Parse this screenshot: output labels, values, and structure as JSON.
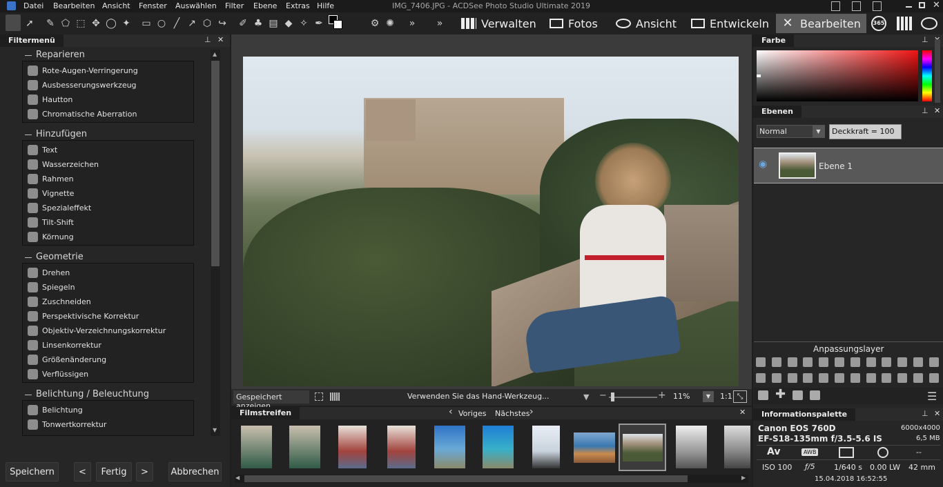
{
  "window": {
    "title": "IMG_7406.JPG - ACDSee Photo Studio Ultimate 2019"
  },
  "menu": [
    "Datei",
    "Bearbeiten",
    "Ansicht",
    "Fenster",
    "Auswählen",
    "Filter",
    "Ebene",
    "Extras",
    "Hilfe"
  ],
  "modes": [
    {
      "label": "Verwalten",
      "icon": "grid-icon"
    },
    {
      "label": "Fotos",
      "icon": "photos-icon"
    },
    {
      "label": "Ansicht",
      "icon": "eye-icon"
    },
    {
      "label": "Entwickeln",
      "icon": "develop-icon"
    },
    {
      "label": "Bearbeiten",
      "icon": "edit-icon",
      "active": true
    }
  ],
  "mode_extra": [
    "365"
  ],
  "filter_panel": {
    "title": "Filtermenü",
    "groups": [
      {
        "label": "Reparieren",
        "items": [
          "Rote-Augen-Verringerung",
          "Ausbesserungswerkzeug",
          "Hautton",
          "Chromatische Aberration"
        ]
      },
      {
        "label": "Hinzufügen",
        "items": [
          "Text",
          "Wasserzeichen",
          "Rahmen",
          "Vignette",
          "Spezialeffekt",
          "Tilt-Shift",
          "Körnung"
        ]
      },
      {
        "label": "Geometrie",
        "items": [
          "Drehen",
          "Spiegeln",
          "Zuschneiden",
          "Perspektivische Korrektur",
          "Objektiv-Verzeichnungskorrektur",
          "Linsenkorrektur",
          "Größenänderung",
          "Verflüssigen"
        ]
      },
      {
        "label": "Belichtung / Beleuchtung",
        "items": [
          "Belichtung",
          "Tonwertkorrektur"
        ]
      }
    ]
  },
  "bottom_buttons": {
    "save": "Speichern",
    "prev": "<",
    "done": "Fertig",
    "next": ">",
    "cancel": "Abbrechen"
  },
  "statusbar": {
    "show_saved": "Gespeichert anzeigen",
    "hint": "Verwenden Sie das Hand-Werkzeug...",
    "zoom": "11%",
    "ratio": "1:1"
  },
  "filmstrip": {
    "title": "Filmstreifen",
    "prev": "Voriges",
    "next": "Nächstes"
  },
  "color_panel": {
    "title": "Farbe"
  },
  "layers_panel": {
    "title": "Ebenen",
    "blend_mode": "Normal",
    "opacity": "Deckkraft = 100",
    "layer_name": "Ebene 1"
  },
  "adjust_panel": {
    "title": "Anpassungslayer"
  },
  "info_panel": {
    "title": "Informationspalette",
    "camera": "Canon EOS 760D",
    "resolution": "6000x4000",
    "lens": "EF-S18-135mm f/3.5-5.6 IS",
    "size": "6,5 MB",
    "icons": [
      "Av",
      "AWB",
      "--"
    ],
    "iso": "ISO 100",
    "aperture": "ƒ/5",
    "shutter": "1/640 s",
    "ev": "0.00 LW",
    "focal": "42 mm",
    "date": "15.04.2018 16:52:55"
  }
}
